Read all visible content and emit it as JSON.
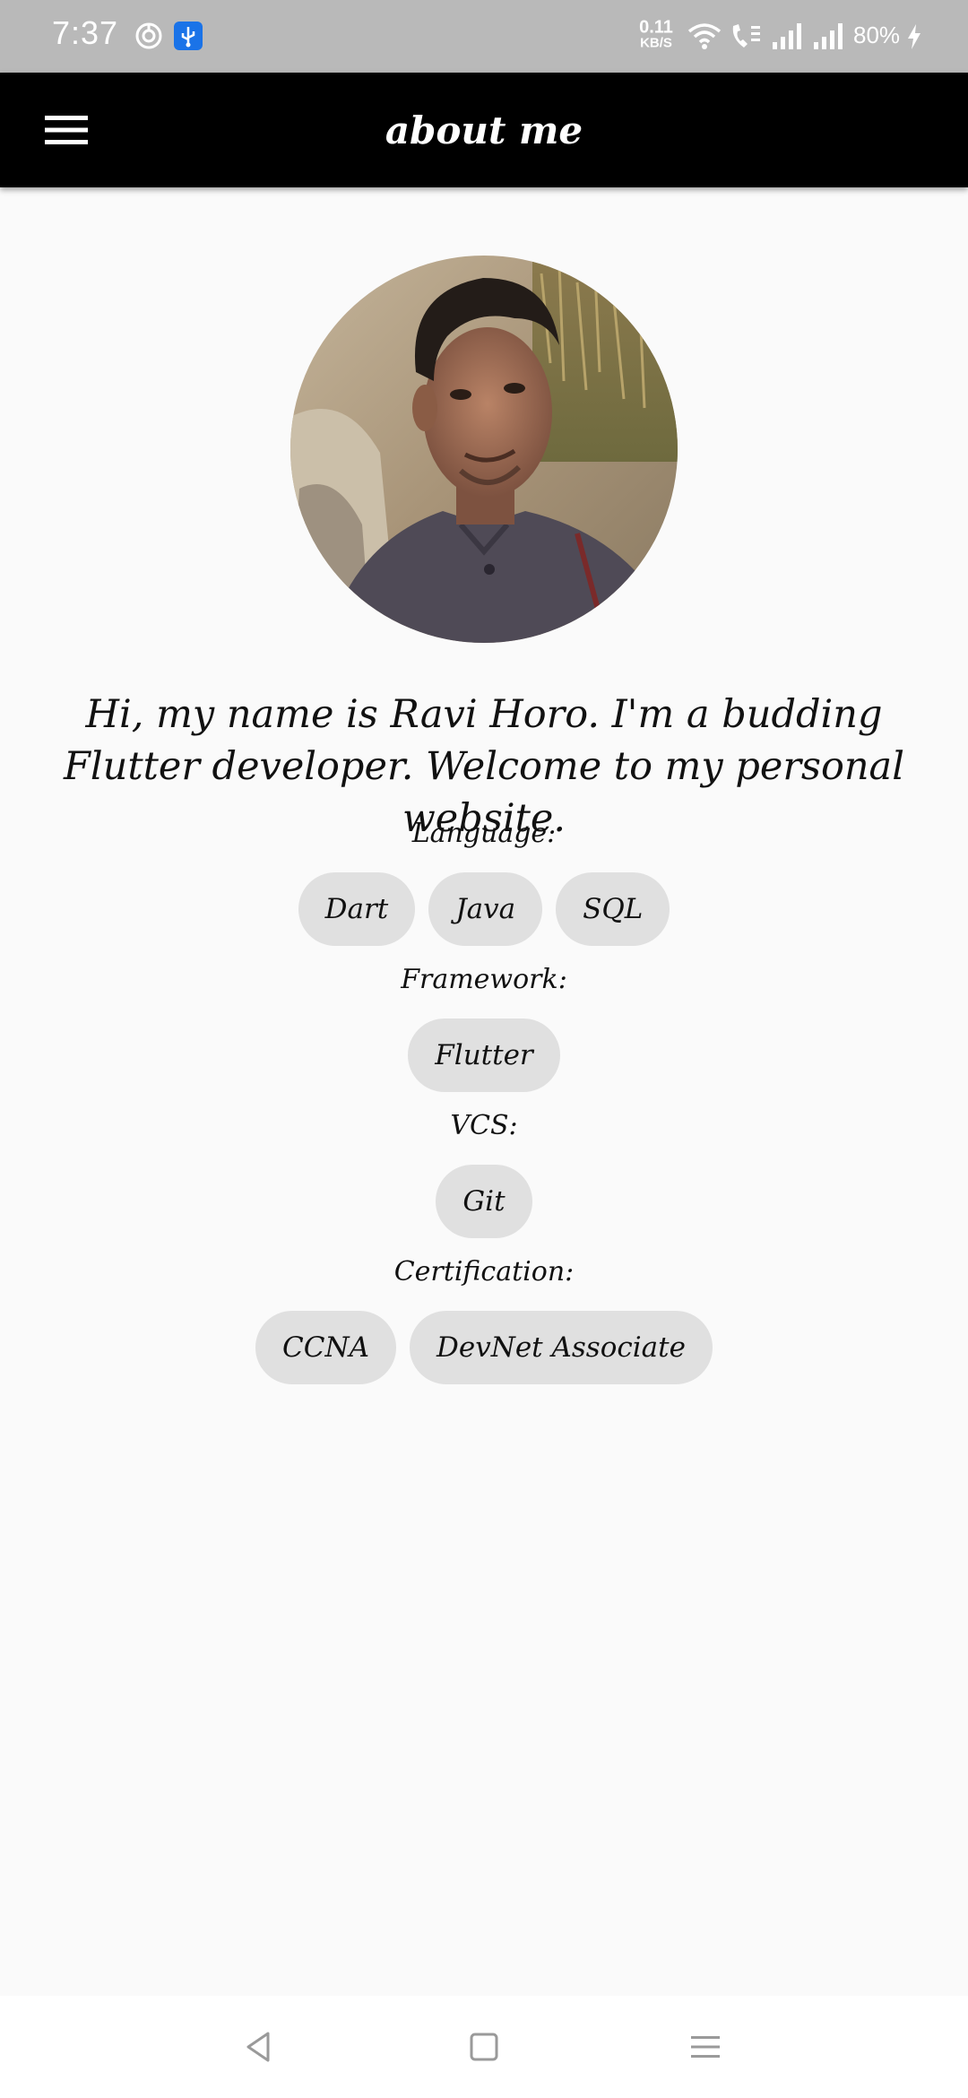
{
  "status_bar": {
    "time": "7:37",
    "net_speed_value": "0.11",
    "net_speed_unit": "KB/S",
    "battery": "80%"
  },
  "app_bar": {
    "title": "about me",
    "menu_icon": "hamburger-menu-icon",
    "background": "#000000"
  },
  "profile": {
    "photo_alt": "Profile photo"
  },
  "intro": "Hi, my name is Ravi Horo. I'm a budding Flutter developer. Welcome to my personal website.",
  "sections": {
    "language": {
      "label": "Language:",
      "chips": [
        "Dart",
        "Java",
        "SQL"
      ]
    },
    "framework": {
      "label": "Framework:",
      "chips": [
        "Flutter"
      ]
    },
    "vcs": {
      "label": "VCS:",
      "chips": [
        "Git"
      ]
    },
    "certification": {
      "label": "Certification:",
      "chips": [
        "CCNA",
        "DevNet Associate"
      ]
    }
  },
  "colors": {
    "chip_background": "#e0e0e0",
    "page_background": "#fafafa",
    "status_bar": "#b9b9b9"
  },
  "nav_bar": {
    "back_icon": "back-triangle-icon",
    "home_icon": "home-square-icon",
    "recents_icon": "recents-menu-icon"
  }
}
